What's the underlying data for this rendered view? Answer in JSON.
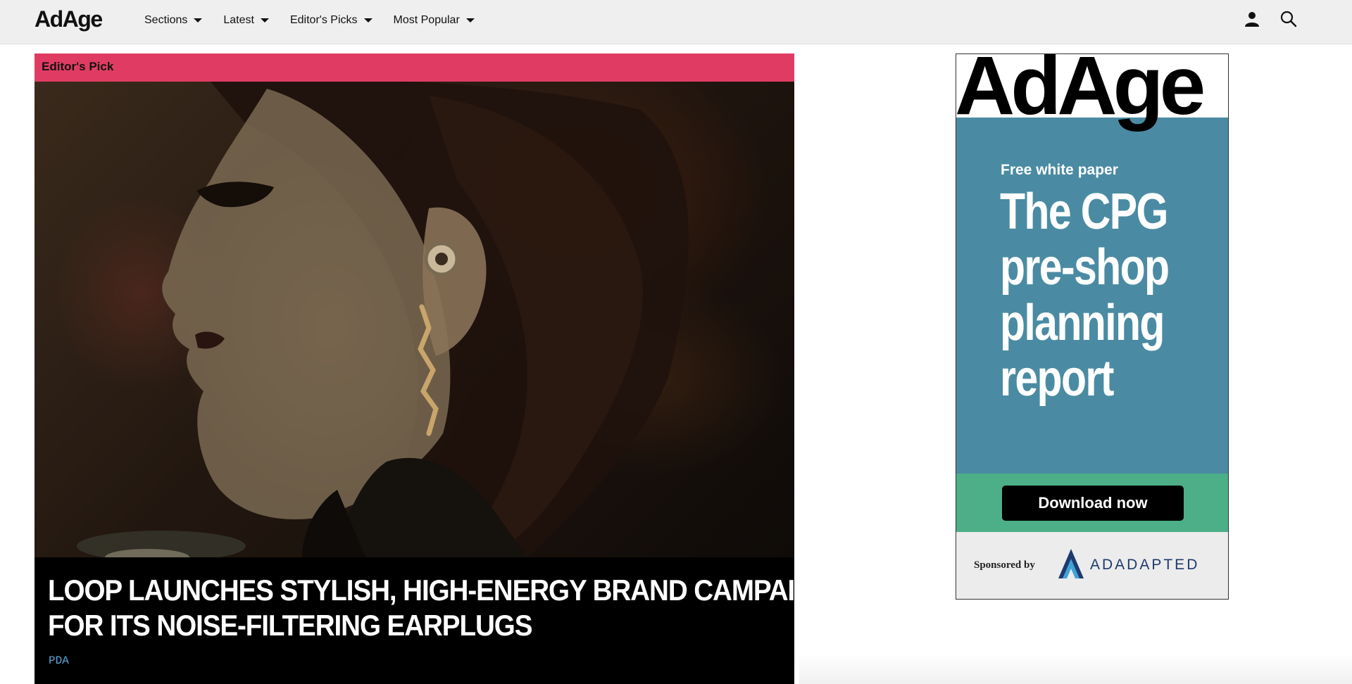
{
  "header": {
    "logo": "AdAge",
    "nav": [
      {
        "label": "Sections"
      },
      {
        "label": "Latest"
      },
      {
        "label": "Editor's Picks"
      },
      {
        "label": "Most Popular"
      }
    ],
    "icons": {
      "account": "user-icon",
      "search": "search-icon"
    }
  },
  "feature": {
    "badge": "Editor's Pick",
    "headline_line1": "LOOP LAUNCHES STYLISH, HIGH-ENERGY BRAND CAMPAIGN",
    "headline_line2": "FOR ITS NOISE-FILTERING EARPLUGS",
    "brand": "PDA",
    "badge_color": "#e03c63",
    "brand_color": "#5aa7d8"
  },
  "ad": {
    "logo": "AdAge",
    "eyebrow": "Free white paper",
    "title_lines": [
      "The CPG",
      "pre-shop",
      "planning",
      "report"
    ],
    "cta": "Download now",
    "sponsored_by": "Sponsored by",
    "sponsor": "ADADAPTED",
    "colors": {
      "background": "#4a8ba3",
      "cta_band": "#4caf87",
      "sponsor_band": "#ececec"
    }
  }
}
